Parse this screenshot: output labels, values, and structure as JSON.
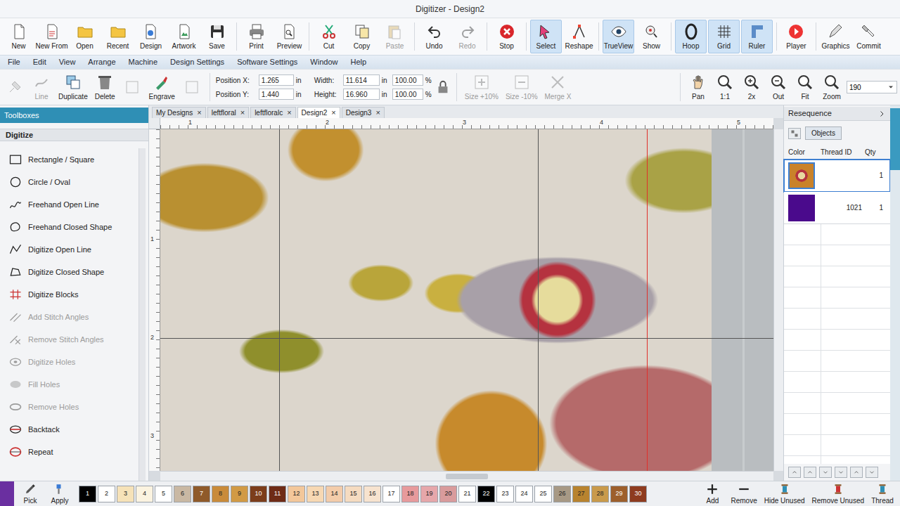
{
  "window": {
    "title": "Digitizer - Design2"
  },
  "toolbar": [
    {
      "label": "New",
      "selected": false,
      "disabled": false
    },
    {
      "label": "New From",
      "selected": false,
      "disabled": false
    },
    {
      "label": "Open",
      "selected": false,
      "disabled": false
    },
    {
      "label": "Recent",
      "selected": false,
      "disabled": false
    },
    {
      "label": "Design",
      "selected": false,
      "disabled": false
    },
    {
      "label": "Artwork",
      "selected": false,
      "disabled": false
    },
    {
      "label": "Save",
      "selected": false,
      "disabled": false
    },
    {
      "label": "Print",
      "selected": false,
      "disabled": false
    },
    {
      "label": "Preview",
      "selected": false,
      "disabled": false
    },
    {
      "label": "Cut",
      "selected": false,
      "disabled": false
    },
    {
      "label": "Copy",
      "selected": false,
      "disabled": false
    },
    {
      "label": "Paste",
      "selected": false,
      "disabled": true
    },
    {
      "label": "Undo",
      "selected": false,
      "disabled": false
    },
    {
      "label": "Redo",
      "selected": false,
      "disabled": true
    },
    {
      "label": "Stop",
      "selected": false,
      "disabled": false
    },
    {
      "label": "Select",
      "selected": true,
      "disabled": false
    },
    {
      "label": "Reshape",
      "selected": false,
      "disabled": false
    },
    {
      "label": "TrueView",
      "selected": true,
      "disabled": false
    },
    {
      "label": "Show",
      "selected": false,
      "disabled": false
    },
    {
      "label": "Hoop",
      "selected": true,
      "disabled": false
    },
    {
      "label": "Grid",
      "selected": true,
      "disabled": false
    },
    {
      "label": "Ruler",
      "selected": true,
      "disabled": false
    },
    {
      "label": "Player",
      "selected": false,
      "disabled": false
    },
    {
      "label": "Graphics",
      "selected": false,
      "disabled": false
    },
    {
      "label": "Commit",
      "selected": false,
      "disabled": false
    }
  ],
  "menu": [
    "File",
    "Edit",
    "View",
    "Arrange",
    "Machine",
    "Design Settings",
    "Software Settings",
    "Window",
    "Help"
  ],
  "property_bar": {
    "tools": [
      {
        "disabled": true
      },
      {
        "label": "Line",
        "disabled": true
      },
      {
        "label": "Duplicate",
        "disabled": false
      },
      {
        "label": "Delete",
        "disabled": false
      },
      {
        "disabled": true
      },
      {
        "label": "Engrave",
        "disabled": false
      },
      {
        "disabled": true
      }
    ],
    "position": [
      {
        "label": "Position X:",
        "value": "1.265",
        "unit": "in"
      },
      {
        "label": "Position Y:",
        "value": "1.440",
        "unit": "in"
      }
    ],
    "size": [
      {
        "label": "Width:",
        "value": "11.614",
        "unit": "in",
        "percent": "100.00",
        "percent_unit": "%"
      },
      {
        "label": "Height:",
        "value": "16.960",
        "unit": "in",
        "percent": "100.00",
        "percent_unit": "%"
      }
    ],
    "resize": [
      {
        "label": "Size +10%",
        "disabled": true
      },
      {
        "label": "Size -10%",
        "disabled": true
      },
      {
        "label": "Merge X",
        "disabled": true
      }
    ],
    "view": [
      {
        "label": "Pan"
      },
      {
        "label": "1:1"
      },
      {
        "label": "2x"
      },
      {
        "label": "Out"
      },
      {
        "label": "Fit"
      },
      {
        "label": "Zoom"
      }
    ],
    "zoom_value": "190"
  },
  "doc_tabs": [
    {
      "label": "My Designs",
      "close": "×",
      "selected": false
    },
    {
      "label": "leftfloral",
      "close": "×",
      "selected": false
    },
    {
      "label": "leftfloralc",
      "close": "×",
      "selected": false
    },
    {
      "label": "Design2",
      "close": "×",
      "selected": true
    },
    {
      "label": "Design3",
      "close": "×",
      "selected": false
    }
  ],
  "toolbox": {
    "title": "Toolboxes",
    "section": "Digitize",
    "items": [
      {
        "label": "Rectangle / Square",
        "disabled": false
      },
      {
        "label": "Circle / Oval",
        "disabled": false
      },
      {
        "label": "Freehand Open Line",
        "disabled": false
      },
      {
        "label": "Freehand Closed Shape",
        "disabled": false
      },
      {
        "label": "Digitize Open Line",
        "disabled": false
      },
      {
        "label": "Digitize Closed Shape",
        "disabled": false
      },
      {
        "label": "Digitize Blocks",
        "disabled": false
      },
      {
        "label": "Add Stitch Angles",
        "disabled": true
      },
      {
        "label": "Remove Stitch Angles",
        "disabled": true
      },
      {
        "label": "Digitize Holes",
        "disabled": true
      },
      {
        "label": "Fill Holes",
        "disabled": true
      },
      {
        "label": "Remove Holes",
        "disabled": true
      },
      {
        "label": "Backtack",
        "disabled": false
      },
      {
        "label": "Repeat",
        "disabled": false
      }
    ]
  },
  "canvas": {
    "ruler_top": [
      "1",
      "2",
      "3",
      "4",
      "5"
    ],
    "ruler_left": [
      "1",
      "2",
      "3"
    ]
  },
  "resequence": {
    "title": "Resequence",
    "button": "Objects",
    "columns": [
      "Color",
      "Thread ID",
      "Qty"
    ],
    "rows": [
      {
        "kind": "image",
        "qty": "1",
        "selected": true
      },
      {
        "kind": "swatch",
        "color": "#4a0a8c",
        "thread_id": "1021",
        "qty": "1",
        "selected": false
      }
    ]
  },
  "palette": [
    {
      "number": "1",
      "color": "#000000"
    },
    {
      "number": "2",
      "color": "#ffffff"
    },
    {
      "number": "3",
      "color": "#f6e2b8"
    },
    {
      "number": "4",
      "color": "#fbf3e0"
    },
    {
      "number": "5",
      "color": "#ffffff"
    },
    {
      "number": "6",
      "color": "#c9b8a3"
    },
    {
      "number": "7",
      "color": "#8f5a2a"
    },
    {
      "number": "8",
      "color": "#c98b3a"
    },
    {
      "number": "9",
      "color": "#d19a45"
    },
    {
      "number": "10",
      "color": "#7c3d1b"
    },
    {
      "number": "11",
      "color": "#6e2b16"
    },
    {
      "number": "12",
      "color": "#f3c79a"
    },
    {
      "number": "13",
      "color": "#f7d8b3"
    },
    {
      "number": "14",
      "color": "#f3ccaa"
    },
    {
      "number": "15",
      "color": "#f5dbc0"
    },
    {
      "number": "16",
      "color": "#f7e3cf"
    },
    {
      "number": "17",
      "color": "#ffffff"
    },
    {
      "number": "18",
      "color": "#e79a9c"
    },
    {
      "number": "19",
      "color": "#e6a7aa"
    },
    {
      "number": "20",
      "color": "#d99b9c"
    },
    {
      "number": "21",
      "color": "#ffffff"
    },
    {
      "number": "22",
      "color": "#000000"
    },
    {
      "number": "23",
      "color": "#ffffff"
    },
    {
      "number": "24",
      "color": "#ffffff"
    },
    {
      "number": "25",
      "color": "#ffffff"
    },
    {
      "number": "26",
      "color": "#a79985"
    },
    {
      "number": "27",
      "color": "#b8832f"
    },
    {
      "number": "28",
      "color": "#c99a4b"
    },
    {
      "number": "29",
      "color": "#9d5f2c"
    },
    {
      "number": "30",
      "color": "#8e3b1f"
    }
  ],
  "bottom_bar": {
    "left": [
      {
        "label": "Pick"
      },
      {
        "label": "Apply"
      }
    ],
    "right": [
      {
        "label": "Add"
      },
      {
        "label": "Remove"
      },
      {
        "label": "Hide Unused"
      },
      {
        "label": "Remove Unused"
      },
      {
        "label": "Thread"
      }
    ]
  }
}
